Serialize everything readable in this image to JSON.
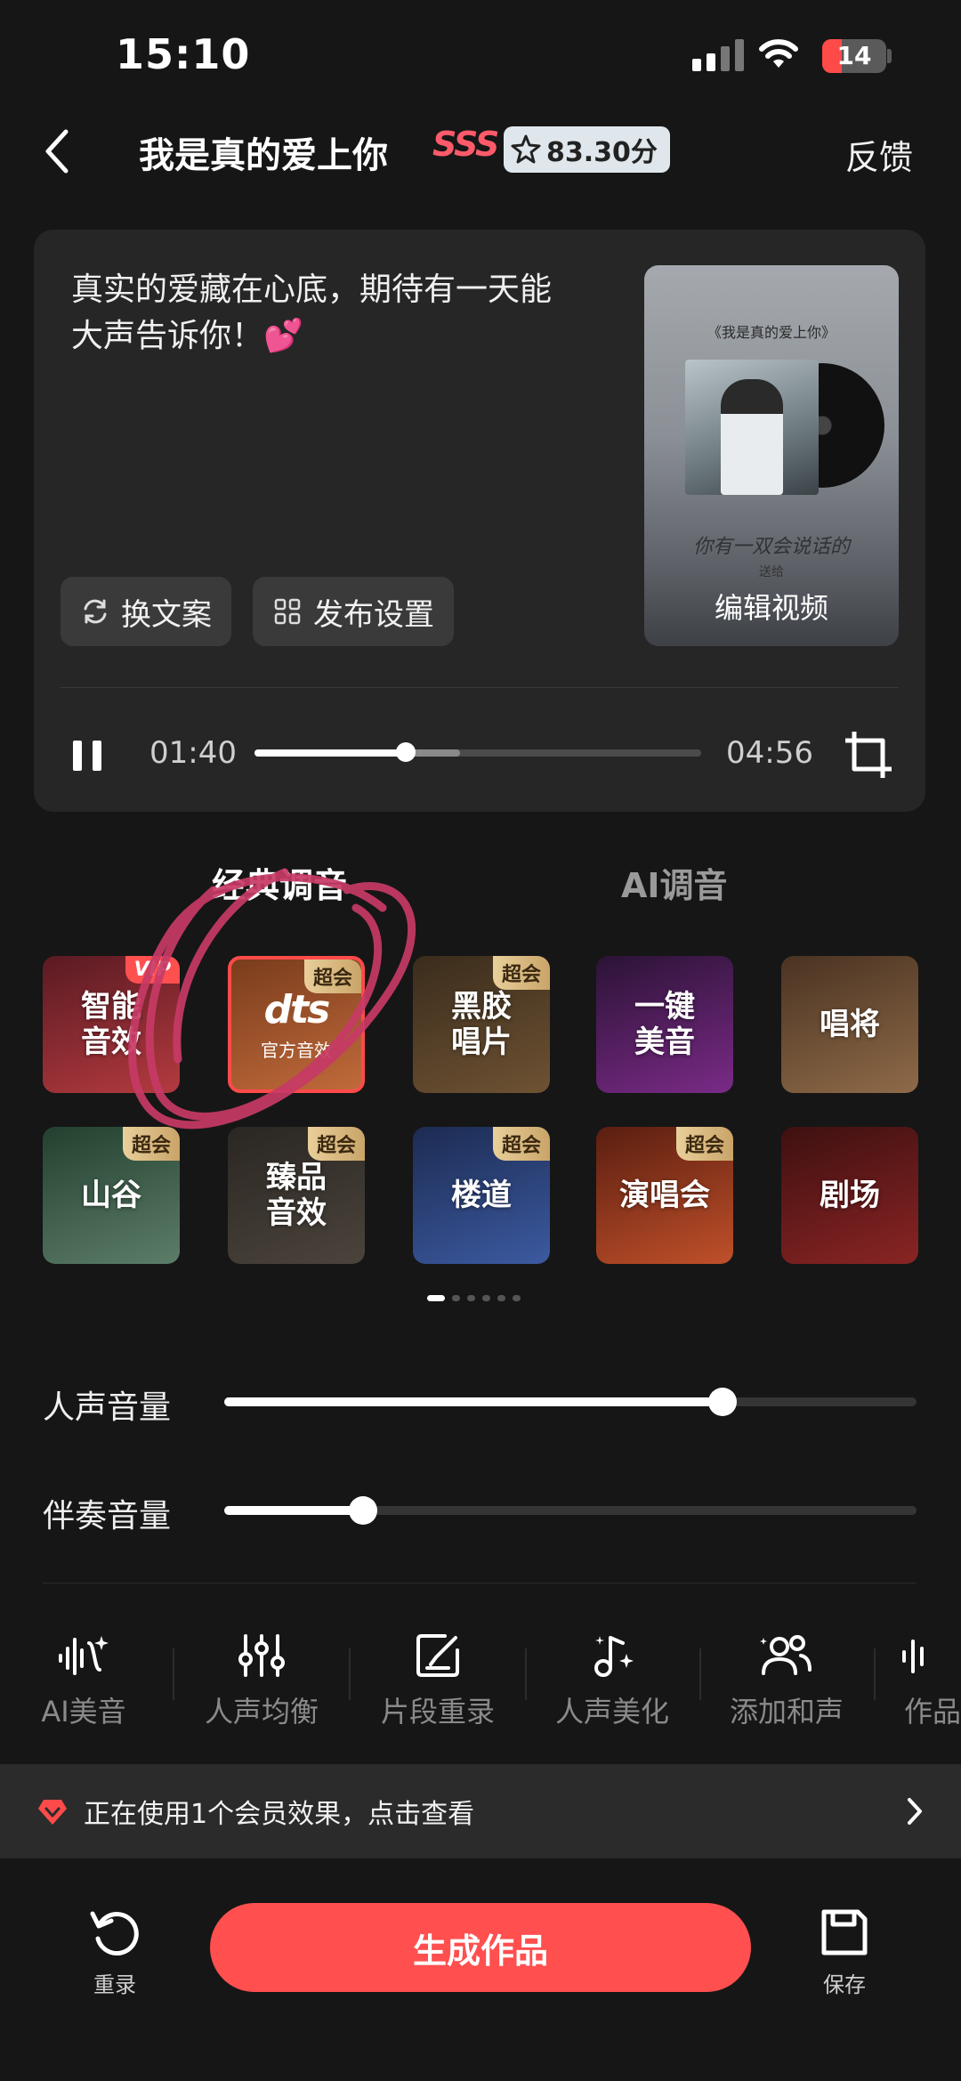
{
  "status_bar": {
    "time": "15:10",
    "battery": "14"
  },
  "header": {
    "back_icon": "chevron-left-icon",
    "song_title": "我是真的爱上你",
    "rank": "SSS",
    "score": "83.30分",
    "feedback": "反馈"
  },
  "card": {
    "quote": "真实的爱藏在心底，期待有一天能大声告诉你！💕",
    "buttons": [
      {
        "label": "换文案",
        "icon": "refresh-icon"
      },
      {
        "label": "发布设置",
        "icon": "grid-icon"
      }
    ],
    "cover": {
      "title": "《我是真的爱上你》",
      "script": "你有一双会说话的",
      "small": "送给",
      "label": "编辑视频"
    },
    "player": {
      "current": "01:40",
      "total": "04:56",
      "progress": 0.338,
      "buffered": 0.46
    }
  },
  "tabs": [
    {
      "label": "经典调音",
      "active": true
    },
    {
      "label": "AI调音",
      "active": false
    }
  ],
  "effects": [
    {
      "label": "智能\n音效",
      "badge": "VIP",
      "colors": [
        "#5a1a22",
        "#b33a3f"
      ]
    },
    {
      "label": "官方音效",
      "logo": "dts",
      "badge": "超会",
      "selected": true,
      "colors": [
        "#7a3c1c",
        "#c06a3a"
      ]
    },
    {
      "label": "黑胶\n唱片",
      "badge": "超会",
      "colors": [
        "#3a2c1c",
        "#6e5233"
      ]
    },
    {
      "label": "一键\n美音",
      "badge": "",
      "colors": [
        "#2b1336",
        "#7a2a86"
      ]
    },
    {
      "label": "唱将",
      "badge": "",
      "colors": [
        "#4a3322",
        "#8e6a48"
      ]
    },
    {
      "label": "山谷",
      "badge": "超会",
      "colors": [
        "#23402f",
        "#5c7d68"
      ]
    },
    {
      "label": "臻品\n音效",
      "badge": "超会",
      "colors": [
        "#2a2622",
        "#4b443c"
      ]
    },
    {
      "label": "楼道",
      "badge": "超会",
      "colors": [
        "#1c2b52",
        "#3c5aa0"
      ]
    },
    {
      "label": "演唱会",
      "badge": "超会",
      "colors": [
        "#5a1e10",
        "#c0502a"
      ]
    },
    {
      "label": "剧场",
      "badge": "",
      "colors": [
        "#3e1010",
        "#8a2424"
      ]
    }
  ],
  "page_dots": {
    "count": 6,
    "active": 0
  },
  "sliders": [
    {
      "label": "人声音量",
      "value": 0.72
    },
    {
      "label": "伴奏音量",
      "value": 0.2
    }
  ],
  "tools": [
    {
      "label": "AI美音",
      "icon": "ai-wave-icon"
    },
    {
      "label": "人声均衡",
      "icon": "equalizer-icon"
    },
    {
      "label": "片段重录",
      "icon": "edit-square-icon"
    },
    {
      "label": "人声美化",
      "icon": "music-sparkle-icon"
    },
    {
      "label": "添加和声",
      "icon": "people-icon"
    },
    {
      "label": "作品",
      "icon": "wave-icon"
    }
  ],
  "banner": {
    "text": "正在使用1个会员效果，点击查看",
    "icon": "diamond-heart-icon"
  },
  "bottom": {
    "rerecord": "重录",
    "generate": "生成作品",
    "save": "保存"
  }
}
